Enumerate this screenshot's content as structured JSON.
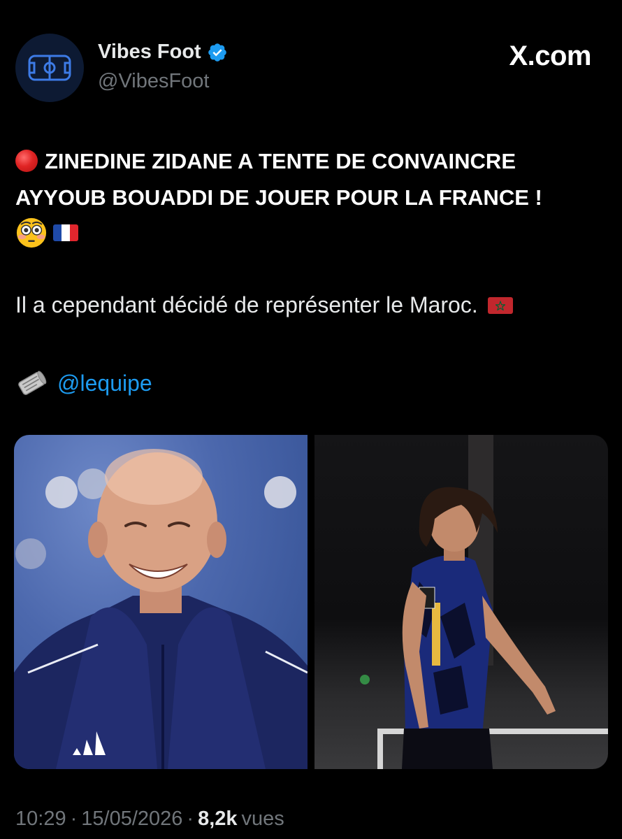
{
  "header": {
    "display_name": "Vibes Foot",
    "handle": "@VibesFoot",
    "site_label": "X.com",
    "avatar_icon": "football-pitch-icon",
    "verified_icon": "verified-badge-icon",
    "verified_color": "#1d9bf0"
  },
  "post": {
    "headline": "ZINEDINE ZIDANE A TENTE DE CONVAINCRE AYYOUB BOUADDI DE JOUER POUR LA FRANCE !",
    "headline_icon": "red-circle-icon",
    "emoji_icons": [
      "flushed-face-icon",
      "france-flag-icon"
    ],
    "secondary_text": "Il a cependant décidé de représenter le Maroc.",
    "secondary_icon": "morocco-flag-icon",
    "source_icon": "newspaper-icon",
    "source_mention": "@lequipe",
    "mention_color": "#1d9bf0"
  },
  "media": {
    "images": [
      {
        "subject": "zidane-photo"
      },
      {
        "subject": "bouaddi-photo"
      }
    ]
  },
  "meta": {
    "time": "10:29",
    "separator": "·",
    "date": "15/05/2026",
    "views_count": "8,2k",
    "views_label": "vues"
  }
}
